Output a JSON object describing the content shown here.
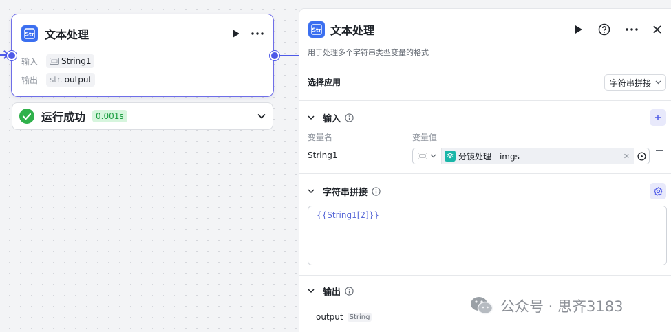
{
  "node": {
    "title": "文本处理",
    "icon": "str-icon",
    "input_label": "输入",
    "input_chip": "String1",
    "output_label": "输出",
    "output_prefix": "str.",
    "output_chip": "output"
  },
  "status": {
    "text": "运行成功",
    "time": "0.001s"
  },
  "panel": {
    "title": "文本处理",
    "description": "用于处理多个字符串类型变量的格式",
    "apply_label": "选择应用",
    "apply_value": "字符串拼接",
    "input_section": "输入",
    "col_var_name": "变量名",
    "col_var_value": "变量值",
    "var_name": "String1",
    "var_value": "分镜处理 - imgs",
    "concat_section": "字符串拼接",
    "template_text": "{{String1[2]}}",
    "output_section": "输出",
    "output_name": "output",
    "output_type": "String"
  },
  "watermark": {
    "text": "公众号 · 思齐3183"
  },
  "colors": {
    "accent": "#4e5ae8",
    "brand": "#3b6ff0",
    "success": "#2fb14b",
    "teal": "#19b6a8"
  }
}
